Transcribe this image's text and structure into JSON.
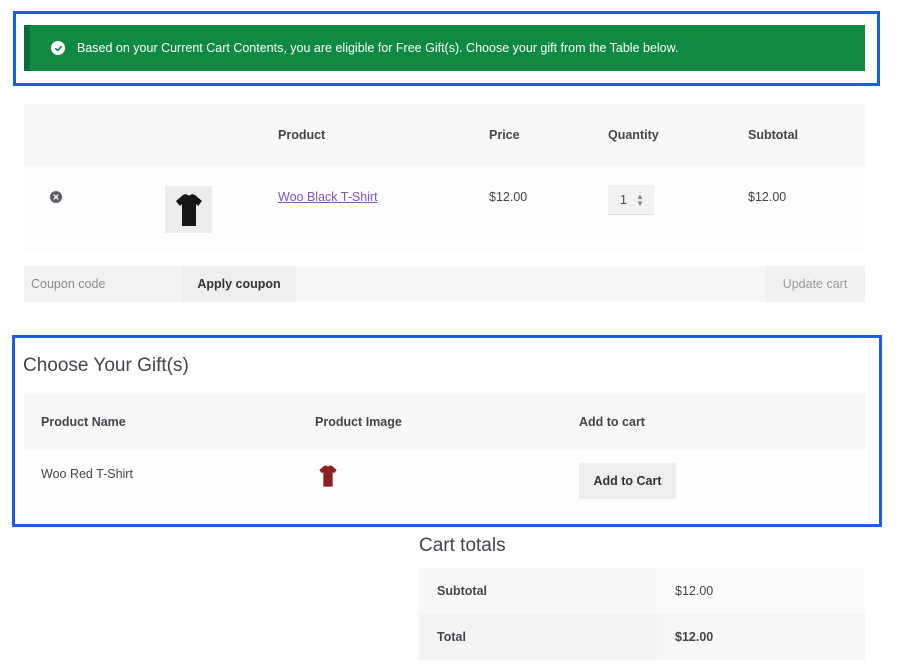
{
  "notice": {
    "message": "Based on your Current Cart Contents, you are eligible for Free Gift(s). Choose your gift from the Table below.",
    "color": "#108a43"
  },
  "cart": {
    "headers": {
      "product": "Product",
      "price": "Price",
      "quantity": "Quantity",
      "subtotal": "Subtotal"
    },
    "items": [
      {
        "name": "Woo Black T-Shirt",
        "price": "$12.00",
        "quantity": "1",
        "subtotal": "$12.00",
        "image_icon": "black-tshirt-icon"
      }
    ]
  },
  "coupon": {
    "placeholder": "Coupon code",
    "apply_label": "Apply coupon",
    "update_label": "Update cart"
  },
  "gifts": {
    "title": "Choose Your Gift(s)",
    "headers": {
      "name": "Product Name",
      "image": "Product Image",
      "add": "Add to cart"
    },
    "items": [
      {
        "name": "Woo Red T-Shirt",
        "button": "Add to Cart",
        "image_icon": "red-tshirt-icon"
      }
    ]
  },
  "totals": {
    "title": "Cart totals",
    "subtotal_label": "Subtotal",
    "subtotal_value": "$12.00",
    "total_label": "Total",
    "total_value": "$12.00"
  },
  "colors": {
    "highlight_border": "#1a5ee8",
    "link": "#7f54b3",
    "notice_bg": "#108a43"
  }
}
